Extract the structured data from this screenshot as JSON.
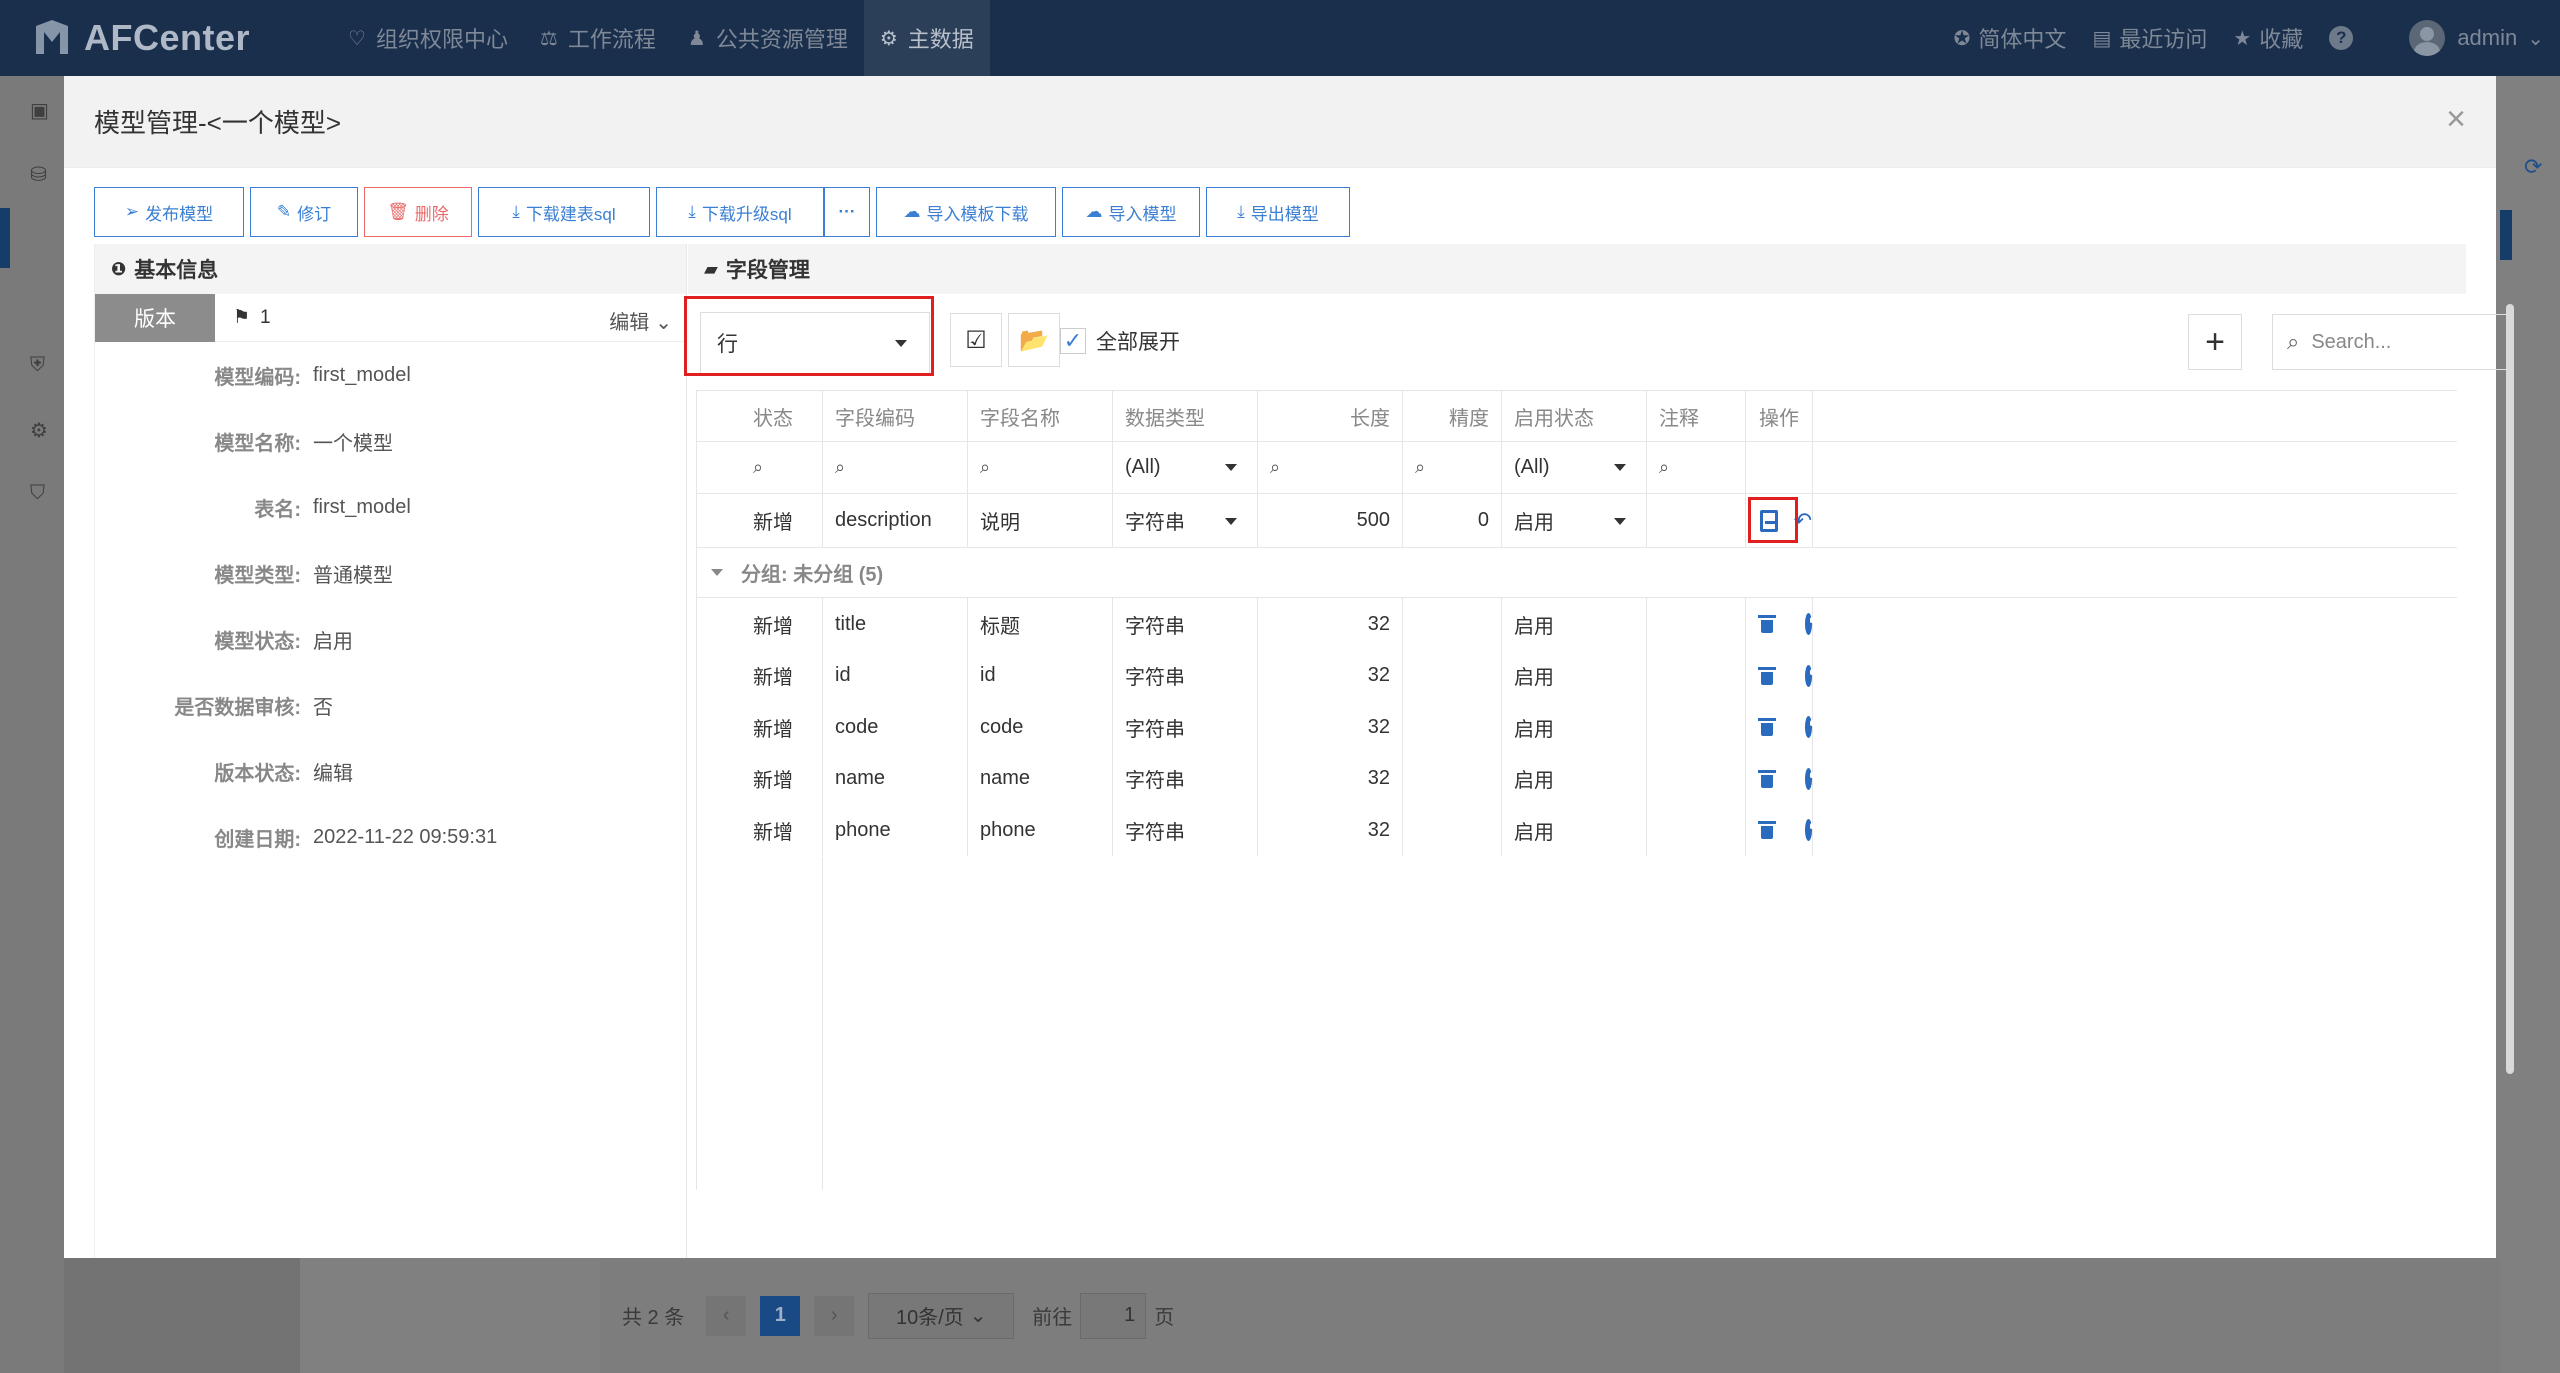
{
  "app": {
    "brand": "AFCenter",
    "nav": [
      "组织权限中心",
      "工作流程",
      "公共资源管理",
      "主数据"
    ],
    "nav_active": "主数据",
    "language": "简体中文",
    "recent": "最近访问",
    "favorites": "收藏",
    "help": "?",
    "user": "admin"
  },
  "modal": {
    "title": "模型管理-<一个模型>",
    "close": "×",
    "toolbar": {
      "publish": "发布模型",
      "revise": "修订",
      "delete": "删除",
      "download_create_sql": "下载建表sql",
      "download_upgrade_sql": "下载升级sql",
      "more": "···",
      "import_template_download": "导入模板下载",
      "import_model": "导入模型",
      "export_model": "导出模型"
    }
  },
  "basic_info": {
    "title": "基本信息",
    "version_tag": "版本",
    "version_number": "1",
    "edit": "编辑",
    "fields": [
      {
        "label": "模型编码:",
        "value": "first_model"
      },
      {
        "label": "模型名称:",
        "value": "一个模型"
      },
      {
        "label": "表名:",
        "value": "first_model"
      },
      {
        "label": "模型类型:",
        "value": "普通模型"
      },
      {
        "label": "模型状态:",
        "value": "启用"
      },
      {
        "label": "是否数据审核:",
        "value": "否"
      },
      {
        "label": "版本状态:",
        "value": "编辑"
      },
      {
        "label": "创建日期:",
        "value": "2022-11-22 09:59:31"
      }
    ]
  },
  "field_mgmt": {
    "title": "字段管理",
    "row_select": "行",
    "expand_all": "全部展开",
    "add": "+",
    "search_placeholder": "Search...",
    "columns": [
      "状态",
      "字段编码",
      "字段名称",
      "数据类型",
      "长度",
      "精度",
      "启用状态",
      "注释",
      "操作"
    ],
    "filter_all": "(All)",
    "editing_row": {
      "status": "新增",
      "code": "description",
      "name": "说明",
      "type": "字符串",
      "length": "500",
      "precision": "0",
      "enabled": "启用",
      "comment": ""
    },
    "group_label": "分组: 未分组 (5)",
    "rows": [
      {
        "status": "新增",
        "code": "title",
        "name": "标题",
        "type": "字符串",
        "length": "32",
        "precision": "",
        "enabled": "启用",
        "comment": ""
      },
      {
        "status": "新增",
        "code": "id",
        "name": "id",
        "type": "字符串",
        "length": "32",
        "precision": "",
        "enabled": "启用",
        "comment": ""
      },
      {
        "status": "新增",
        "code": "code",
        "name": "code",
        "type": "字符串",
        "length": "32",
        "precision": "",
        "enabled": "启用",
        "comment": ""
      },
      {
        "status": "新增",
        "code": "name",
        "name": "name",
        "type": "字符串",
        "length": "32",
        "precision": "",
        "enabled": "启用",
        "comment": ""
      },
      {
        "status": "新增",
        "code": "phone",
        "name": "phone",
        "type": "字符串",
        "length": "32",
        "precision": "",
        "enabled": "启用",
        "comment": ""
      }
    ]
  },
  "pager": {
    "total": "共 2 条",
    "prev": "‹",
    "current": "1",
    "next": "›",
    "page_size": "10条/页",
    "goto": "前往",
    "goto_value": "1",
    "page_unit": "页"
  }
}
